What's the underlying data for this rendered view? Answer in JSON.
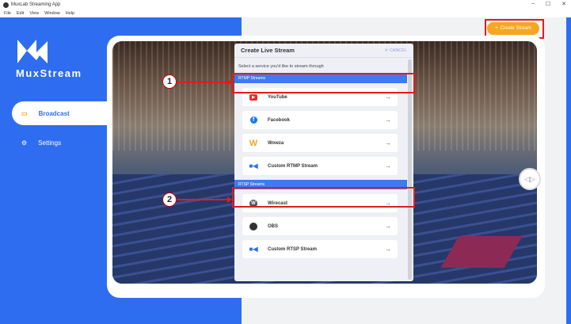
{
  "window": {
    "title": "MuxLab Streaming App",
    "menu": [
      "File",
      "Edit",
      "View",
      "Window",
      "Help"
    ],
    "controls": [
      "–",
      "☐",
      "✕"
    ]
  },
  "sidebar": {
    "brand": "MuxStream",
    "items": [
      {
        "label": "Broadcast",
        "active": true
      },
      {
        "label": "Settings",
        "active": false
      }
    ]
  },
  "header": {
    "create_stream_label": "Create Stream"
  },
  "modal": {
    "title": "Create Live Stream",
    "cancel_label": "CANCEL",
    "subtitle": "Select a service you'd like to stream through",
    "sections": [
      {
        "title": "RTMP Streams",
        "items": [
          "YouTube",
          "Facebook",
          "Wowza",
          "Custom RTMP Stream"
        ]
      },
      {
        "title": "RTSP Streams",
        "items": [
          "Wirecast",
          "OBS",
          "Custom RTSP Stream"
        ]
      }
    ]
  },
  "annotations": [
    "1",
    "2"
  ],
  "colors": {
    "primary": "#2f6df0",
    "accent": "#f5a623",
    "annotation": "#e41b1b"
  }
}
